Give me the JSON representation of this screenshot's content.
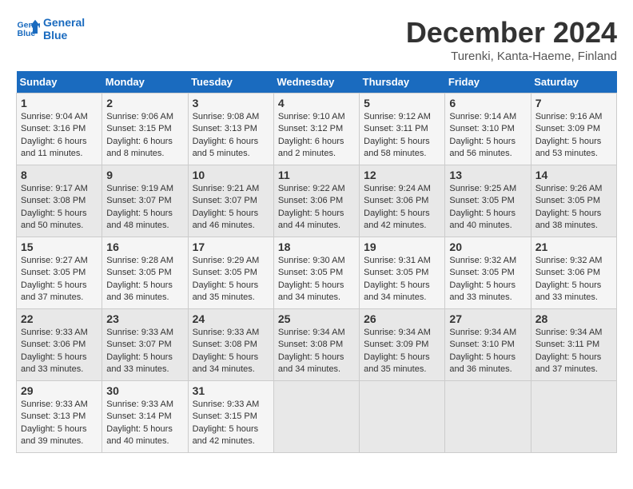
{
  "header": {
    "logo_line1": "General",
    "logo_line2": "Blue",
    "month_year": "December 2024",
    "location": "Turenki, Kanta-Haeme, Finland"
  },
  "days_of_week": [
    "Sunday",
    "Monday",
    "Tuesday",
    "Wednesday",
    "Thursday",
    "Friday",
    "Saturday"
  ],
  "weeks": [
    [
      {
        "day": "1",
        "sunrise": "Sunrise: 9:04 AM",
        "sunset": "Sunset: 3:16 PM",
        "daylight": "Daylight: 6 hours and 11 minutes."
      },
      {
        "day": "2",
        "sunrise": "Sunrise: 9:06 AM",
        "sunset": "Sunset: 3:15 PM",
        "daylight": "Daylight: 6 hours and 8 minutes."
      },
      {
        "day": "3",
        "sunrise": "Sunrise: 9:08 AM",
        "sunset": "Sunset: 3:13 PM",
        "daylight": "Daylight: 6 hours and 5 minutes."
      },
      {
        "day": "4",
        "sunrise": "Sunrise: 9:10 AM",
        "sunset": "Sunset: 3:12 PM",
        "daylight": "Daylight: 6 hours and 2 minutes."
      },
      {
        "day": "5",
        "sunrise": "Sunrise: 9:12 AM",
        "sunset": "Sunset: 3:11 PM",
        "daylight": "Daylight: 5 hours and 58 minutes."
      },
      {
        "day": "6",
        "sunrise": "Sunrise: 9:14 AM",
        "sunset": "Sunset: 3:10 PM",
        "daylight": "Daylight: 5 hours and 56 minutes."
      },
      {
        "day": "7",
        "sunrise": "Sunrise: 9:16 AM",
        "sunset": "Sunset: 3:09 PM",
        "daylight": "Daylight: 5 hours and 53 minutes."
      }
    ],
    [
      {
        "day": "8",
        "sunrise": "Sunrise: 9:17 AM",
        "sunset": "Sunset: 3:08 PM",
        "daylight": "Daylight: 5 hours and 50 minutes."
      },
      {
        "day": "9",
        "sunrise": "Sunrise: 9:19 AM",
        "sunset": "Sunset: 3:07 PM",
        "daylight": "Daylight: 5 hours and 48 minutes."
      },
      {
        "day": "10",
        "sunrise": "Sunrise: 9:21 AM",
        "sunset": "Sunset: 3:07 PM",
        "daylight": "Daylight: 5 hours and 46 minutes."
      },
      {
        "day": "11",
        "sunrise": "Sunrise: 9:22 AM",
        "sunset": "Sunset: 3:06 PM",
        "daylight": "Daylight: 5 hours and 44 minutes."
      },
      {
        "day": "12",
        "sunrise": "Sunrise: 9:24 AM",
        "sunset": "Sunset: 3:06 PM",
        "daylight": "Daylight: 5 hours and 42 minutes."
      },
      {
        "day": "13",
        "sunrise": "Sunrise: 9:25 AM",
        "sunset": "Sunset: 3:05 PM",
        "daylight": "Daylight: 5 hours and 40 minutes."
      },
      {
        "day": "14",
        "sunrise": "Sunrise: 9:26 AM",
        "sunset": "Sunset: 3:05 PM",
        "daylight": "Daylight: 5 hours and 38 minutes."
      }
    ],
    [
      {
        "day": "15",
        "sunrise": "Sunrise: 9:27 AM",
        "sunset": "Sunset: 3:05 PM",
        "daylight": "Daylight: 5 hours and 37 minutes."
      },
      {
        "day": "16",
        "sunrise": "Sunrise: 9:28 AM",
        "sunset": "Sunset: 3:05 PM",
        "daylight": "Daylight: 5 hours and 36 minutes."
      },
      {
        "day": "17",
        "sunrise": "Sunrise: 9:29 AM",
        "sunset": "Sunset: 3:05 PM",
        "daylight": "Daylight: 5 hours and 35 minutes."
      },
      {
        "day": "18",
        "sunrise": "Sunrise: 9:30 AM",
        "sunset": "Sunset: 3:05 PM",
        "daylight": "Daylight: 5 hours and 34 minutes."
      },
      {
        "day": "19",
        "sunrise": "Sunrise: 9:31 AM",
        "sunset": "Sunset: 3:05 PM",
        "daylight": "Daylight: 5 hours and 34 minutes."
      },
      {
        "day": "20",
        "sunrise": "Sunrise: 9:32 AM",
        "sunset": "Sunset: 3:05 PM",
        "daylight": "Daylight: 5 hours and 33 minutes."
      },
      {
        "day": "21",
        "sunrise": "Sunrise: 9:32 AM",
        "sunset": "Sunset: 3:06 PM",
        "daylight": "Daylight: 5 hours and 33 minutes."
      }
    ],
    [
      {
        "day": "22",
        "sunrise": "Sunrise: 9:33 AM",
        "sunset": "Sunset: 3:06 PM",
        "daylight": "Daylight: 5 hours and 33 minutes."
      },
      {
        "day": "23",
        "sunrise": "Sunrise: 9:33 AM",
        "sunset": "Sunset: 3:07 PM",
        "daylight": "Daylight: 5 hours and 33 minutes."
      },
      {
        "day": "24",
        "sunrise": "Sunrise: 9:33 AM",
        "sunset": "Sunset: 3:08 PM",
        "daylight": "Daylight: 5 hours and 34 minutes."
      },
      {
        "day": "25",
        "sunrise": "Sunrise: 9:34 AM",
        "sunset": "Sunset: 3:08 PM",
        "daylight": "Daylight: 5 hours and 34 minutes."
      },
      {
        "day": "26",
        "sunrise": "Sunrise: 9:34 AM",
        "sunset": "Sunset: 3:09 PM",
        "daylight": "Daylight: 5 hours and 35 minutes."
      },
      {
        "day": "27",
        "sunrise": "Sunrise: 9:34 AM",
        "sunset": "Sunset: 3:10 PM",
        "daylight": "Daylight: 5 hours and 36 minutes."
      },
      {
        "day": "28",
        "sunrise": "Sunrise: 9:34 AM",
        "sunset": "Sunset: 3:11 PM",
        "daylight": "Daylight: 5 hours and 37 minutes."
      }
    ],
    [
      {
        "day": "29",
        "sunrise": "Sunrise: 9:33 AM",
        "sunset": "Sunset: 3:13 PM",
        "daylight": "Daylight: 5 hours and 39 minutes."
      },
      {
        "day": "30",
        "sunrise": "Sunrise: 9:33 AM",
        "sunset": "Sunset: 3:14 PM",
        "daylight": "Daylight: 5 hours and 40 minutes."
      },
      {
        "day": "31",
        "sunrise": "Sunrise: 9:33 AM",
        "sunset": "Sunset: 3:15 PM",
        "daylight": "Daylight: 5 hours and 42 minutes."
      },
      null,
      null,
      null,
      null
    ]
  ]
}
